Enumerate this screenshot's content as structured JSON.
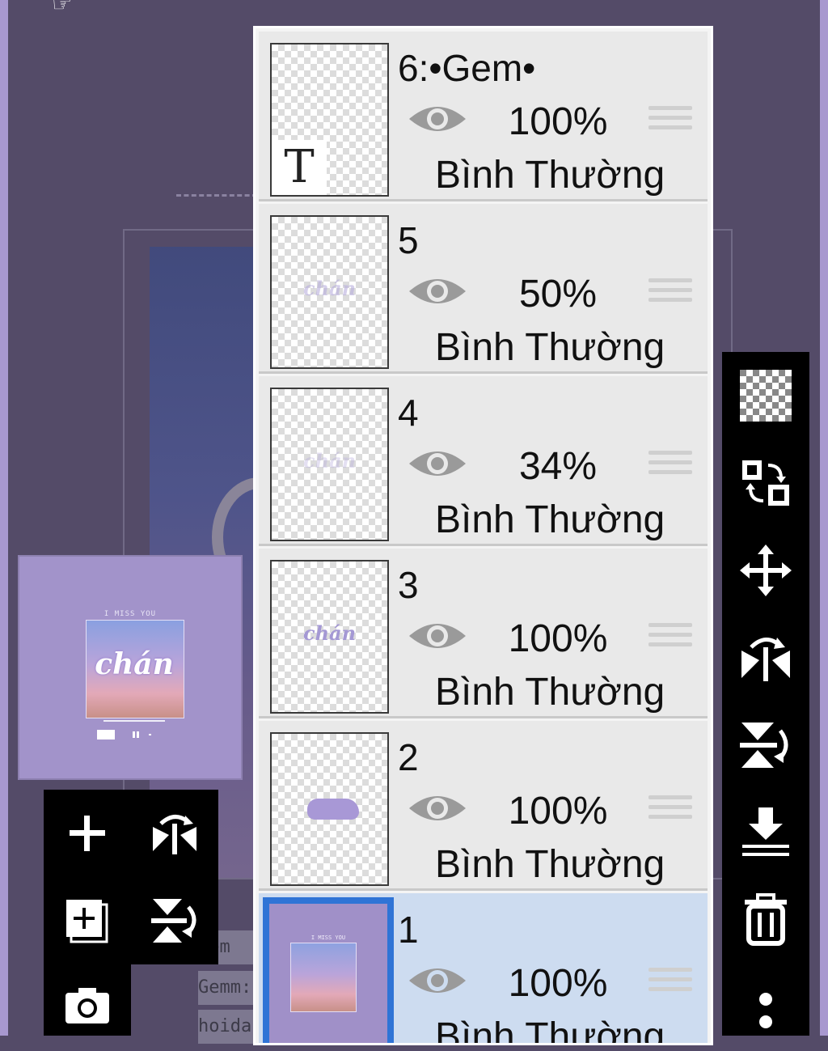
{
  "canvas": {
    "text_lines": [
      "Gem",
      "Gemm:",
      "hoida"
    ]
  },
  "preview": {
    "title": "I MISS YOU",
    "word": "chán"
  },
  "layers": [
    {
      "name": "6:•Gem•",
      "opacity": "100%",
      "blend": "Bình Thường",
      "type": "text",
      "thumb_glyph": "T",
      "visible": true,
      "selected": false
    },
    {
      "name": "5",
      "opacity": "50%",
      "blend": "Bình Thường",
      "type": "word-faint",
      "thumb_word": "chán",
      "visible": true,
      "selected": false
    },
    {
      "name": "4",
      "opacity": "34%",
      "blend": "Bình Thường",
      "type": "word-fainter",
      "thumb_word": "chán",
      "visible": true,
      "selected": false
    },
    {
      "name": "3",
      "opacity": "100%",
      "blend": "Bình Thường",
      "type": "word",
      "thumb_word": "chán",
      "visible": true,
      "selected": false
    },
    {
      "name": "2",
      "opacity": "100%",
      "blend": "Bình Thường",
      "type": "cloud",
      "visible": true,
      "selected": false
    },
    {
      "name": "1",
      "opacity": "100%",
      "blend": "Bình Thường",
      "type": "image",
      "thumb_title": "I MISS YOU",
      "visible": true,
      "selected": true
    }
  ],
  "right_toolbar": [
    "transparency-icon",
    "swap-layers-icon",
    "move-icon",
    "flip-horizontal-icon",
    "flip-vertical-icon",
    "merge-down-icon",
    "trash-icon",
    "more-vertical-icon"
  ],
  "left_toolbar": [
    "add-layer-icon",
    "flip-horizontal-icon",
    "add-copy-layer-icon",
    "flip-vertical-icon",
    "camera-icon"
  ],
  "colors": {
    "background": "#544b68",
    "selected_row": "#cddcf0",
    "selected_border": "#2f74d6",
    "accent_purple": "#a293ca"
  }
}
